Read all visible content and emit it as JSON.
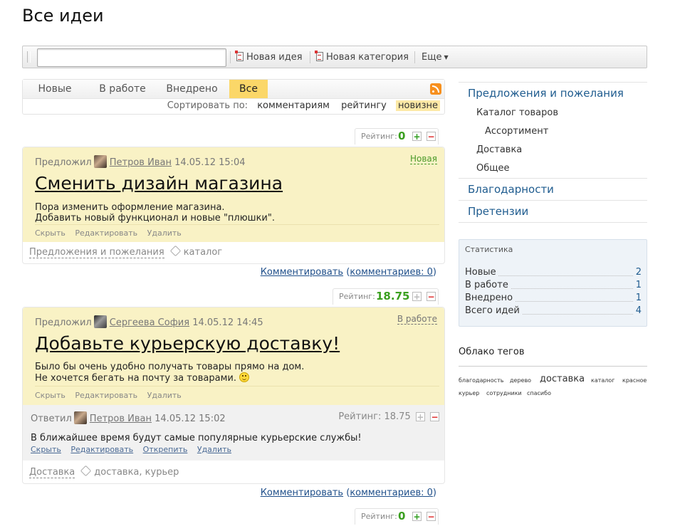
{
  "page": {
    "title": "Все идеи"
  },
  "toolbar": {
    "search_placeholder": "",
    "new_idea": "Новая идея",
    "new_category": "Новая категория",
    "more": "Еще"
  },
  "tabs": [
    {
      "label": "Новые"
    },
    {
      "label": "В работе"
    },
    {
      "label": "Внедрено"
    },
    {
      "label": "Все",
      "active": true
    }
  ],
  "sort": {
    "label": "Сортировать по:",
    "options": [
      {
        "label": "комментариям"
      },
      {
        "label": "рейтингу"
      },
      {
        "label": "новизне",
        "active": true
      }
    ]
  },
  "ideas": [
    {
      "rating_label": "Рейтинг:",
      "rating": "0",
      "author_prefix": "Предложил",
      "author": "Петров Иван",
      "date": "14.05.12 15:04",
      "status": "Новая",
      "title": "Сменить дизайн магазина",
      "text_lines": [
        "Пора изменить оформление магазина.",
        "Добавить новый функционал и новые \"плюшки\"."
      ],
      "actions": [
        "Скрыть",
        "Редактировать",
        "Удалить"
      ],
      "category": "Предложения и пожелания",
      "tags": "каталог",
      "comment_link": "Комментировать",
      "comments_count": "комментариев: 0"
    },
    {
      "rating_label": "Рейтинг:",
      "rating": "18.75",
      "author_prefix": "Предложил",
      "author": "Сергеева София",
      "date": "14.05.12 14:45",
      "status": "В работе",
      "title": "Добавьте курьерскую доставку!",
      "text_lines": [
        "Было бы очень удобно получать товары прямо на дом.",
        "Не хочется бегать на почту за товарами."
      ],
      "actions": [
        "Скрыть",
        "Редактировать",
        "Удалить"
      ],
      "reply": {
        "prefix": "Ответил",
        "author": "Петров Иван",
        "date": "14.05.12 15:02",
        "rating_label": "Рейтинг: 18.75",
        "text": "В ближайшее время будут самые популярные курьерские службы!",
        "actions": [
          "Скрыть",
          "Редактировать",
          "Открепить",
          "Удалить"
        ]
      },
      "category": "Доставка",
      "tags": "доставка, курьер",
      "comment_link": "Комментировать",
      "comments_count": "комментариев: 0"
    },
    {
      "rating_label": "Рейтинг:",
      "rating": "0"
    }
  ],
  "sidebar": {
    "nav": [
      {
        "label": "Предложения и пожелания",
        "level": 0
      },
      {
        "label": "Каталог товаров",
        "level": 1
      },
      {
        "label": "Ассортимент",
        "level": 2
      },
      {
        "label": "Доставка",
        "level": 1
      },
      {
        "label": "Общее",
        "level": 1
      },
      {
        "label": "Благодарности",
        "level": 0
      },
      {
        "label": "Претензии",
        "level": 0
      }
    ],
    "stats": {
      "title": "Статистика",
      "rows": [
        {
          "label": "Новые",
          "value": "2"
        },
        {
          "label": "В работе",
          "value": "1"
        },
        {
          "label": "Внедрено",
          "value": "1"
        },
        {
          "label": "Всего идей",
          "value": "4"
        }
      ]
    },
    "tag_cloud": {
      "title": "Облако тегов",
      "tags": [
        "благодарность",
        "дерево",
        "доставка",
        "каталог",
        "красное",
        "курьер",
        "сотрудники",
        "спасибо"
      ]
    }
  },
  "colors": {
    "accent_tab": "#fbd768",
    "idea_bg": "#f9f2c5",
    "link": "#1f5c8f",
    "rating_green": "#3a9f1f"
  }
}
